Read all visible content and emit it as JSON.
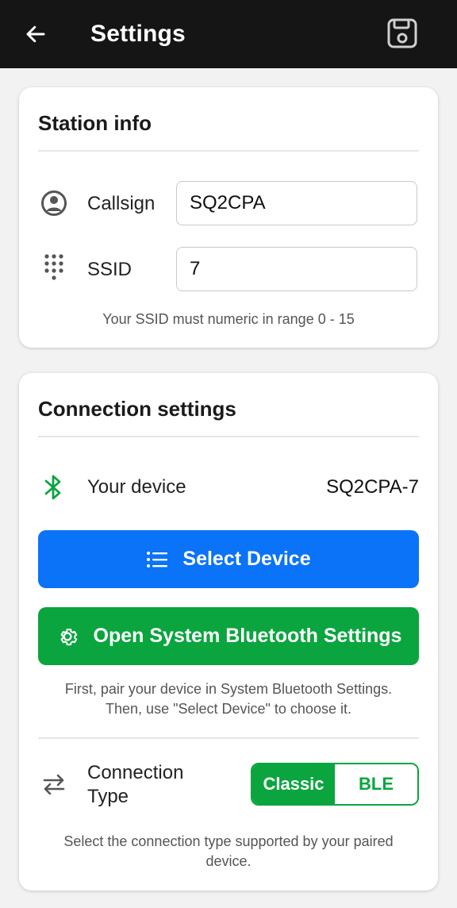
{
  "appbar": {
    "title": "Settings",
    "back_icon": "arrow-left-icon",
    "save_icon": "floppy-disk-icon"
  },
  "station": {
    "title": "Station info",
    "callsign_label": "Callsign",
    "callsign_value": "SQ2CPA",
    "ssid_label": "SSID",
    "ssid_value": "7",
    "ssid_hint": "Your SSID must numeric in range 0 - 15"
  },
  "connection": {
    "title": "Connection settings",
    "device_label": "Your device",
    "device_value": "SQ2CPA-7",
    "select_device_label": "Select Device",
    "open_bt_label": "Open System Bluetooth Settings",
    "pair_hint_line1": "First, pair your device in System Bluetooth Settings.",
    "pair_hint_line2": "Then, use \"Select Device\" to choose it.",
    "type_label_line1": "Connection",
    "type_label_line2": "Type",
    "type_options": [
      "Classic",
      "BLE"
    ],
    "type_selected": "Classic",
    "type_hint_line1": "Select the connection type supported by your paired",
    "type_hint_line2": "device."
  },
  "colors": {
    "primary_blue": "#0a73f7",
    "primary_green": "#0aa53e",
    "appbar": "#151515"
  }
}
